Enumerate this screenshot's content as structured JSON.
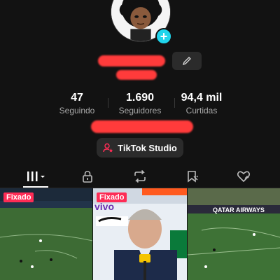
{
  "profile": {
    "avatar_badge": "+",
    "accent_color": "#20d5ec"
  },
  "stats": [
    {
      "value": "47",
      "label": "Seguindo"
    },
    {
      "value": "1.690",
      "label": "Seguidores"
    },
    {
      "value": "94,4 mil",
      "label": "Curtidas"
    }
  ],
  "studio_button": {
    "label": "TikTok Studio",
    "icon": "person-star-icon"
  },
  "tabs": [
    {
      "icon": "grid-icon",
      "active": true
    },
    {
      "icon": "lock-icon",
      "active": false
    },
    {
      "icon": "repost-icon",
      "active": false
    },
    {
      "icon": "bookmark-icon",
      "active": false
    },
    {
      "icon": "liked-heart-icon",
      "active": false
    }
  ],
  "videos": [
    {
      "pinned_label": "Fixado",
      "overlay_text": ""
    },
    {
      "pinned_label": "Fixado",
      "overlay_text": "vivo"
    },
    {
      "pinned_label": "",
      "overlay_text": "QATAR AIRWAYS"
    }
  ],
  "colors": {
    "pin": "#fe2c55",
    "background": "#121212",
    "redaction": "#ff3b3b"
  }
}
